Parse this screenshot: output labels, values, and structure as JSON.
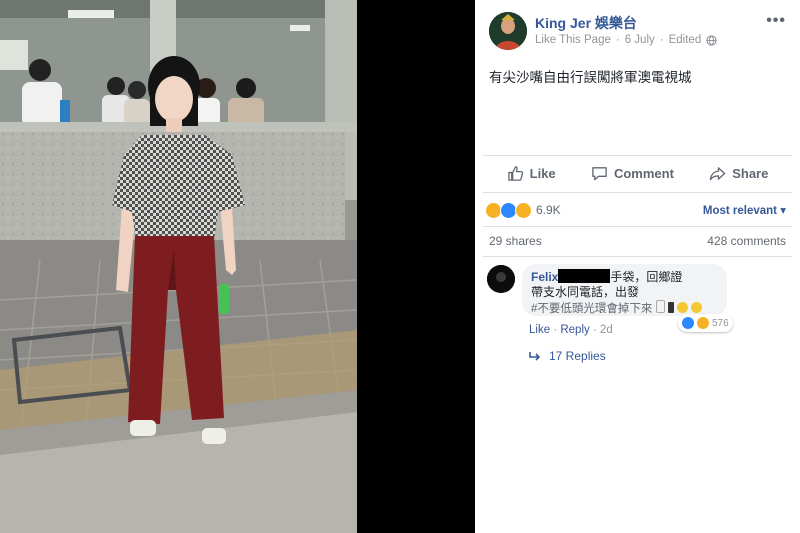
{
  "post": {
    "page_name": "King Jer 娛樂台",
    "meta_link": "Like This Page",
    "date": "6 July",
    "edited": "Edited",
    "text": "有尖沙嘴自由行誤闖將軍澳電視城"
  },
  "actions": {
    "like": "Like",
    "comment": "Comment",
    "share": "Share"
  },
  "reactions": {
    "count": "6.9K",
    "sort_label": "Most relevant",
    "colors": {
      "haha": "#f7b125",
      "like": "#2d88ff",
      "wow": "#f7b125"
    }
  },
  "stats": {
    "shares": "29 shares",
    "comments": "428 comments"
  },
  "comment": {
    "author": "Felix",
    "line1_suffix": "手袋，回鄉證",
    "line2": "帶支水同電話，出發",
    "line3": "#不要低頭光環會掉下來",
    "reaction_count": "576",
    "like": "Like",
    "reply": "Reply",
    "age": "2d",
    "replies": "17 Replies"
  }
}
